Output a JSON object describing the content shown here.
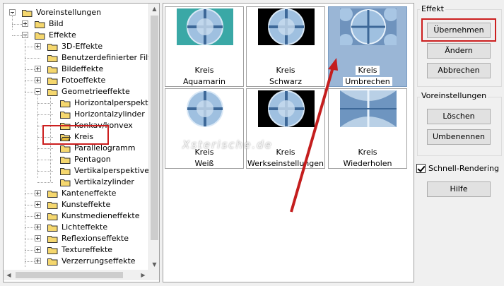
{
  "tree": {
    "items": [
      {
        "label": "Voreinstellungen",
        "level": 0,
        "expander": "minus"
      },
      {
        "label": "Bild",
        "level": 1,
        "expander": "plus"
      },
      {
        "label": "Effekte",
        "level": 1,
        "expander": "minus"
      },
      {
        "label": "3D-Effekte",
        "level": 2,
        "expander": "plus"
      },
      {
        "label": "Benutzerdefinierter Filt",
        "level": 2,
        "expander": "none"
      },
      {
        "label": "Bildeffekte",
        "level": 2,
        "expander": "plus"
      },
      {
        "label": "Fotoeffekte",
        "level": 2,
        "expander": "plus"
      },
      {
        "label": "Geometrieeffekte",
        "level": 2,
        "expander": "minus"
      },
      {
        "label": "Horizontalperspekt",
        "level": 3,
        "expander": "none"
      },
      {
        "label": "Horizontalzylinder",
        "level": 3,
        "expander": "none"
      },
      {
        "label": "Konkav/konvex",
        "level": 3,
        "expander": "none"
      },
      {
        "label": "Kreis",
        "level": 3,
        "expander": "none",
        "selected": true
      },
      {
        "label": "Parallelogramm",
        "level": 3,
        "expander": "none"
      },
      {
        "label": "Pentagon",
        "level": 3,
        "expander": "none"
      },
      {
        "label": "Vertikalperspektive",
        "level": 3,
        "expander": "none"
      },
      {
        "label": "Vertikalzylinder",
        "level": 3,
        "expander": "none"
      },
      {
        "label": "Kanteneffekte",
        "level": 2,
        "expander": "plus"
      },
      {
        "label": "Kunsteffekte",
        "level": 2,
        "expander": "plus"
      },
      {
        "label": "Kunstmedieneffekte",
        "level": 2,
        "expander": "plus"
      },
      {
        "label": "Lichteffekte",
        "level": 2,
        "expander": "plus"
      },
      {
        "label": "Reflexionseffekte",
        "level": 2,
        "expander": "plus"
      },
      {
        "label": "Textureffekte",
        "level": 2,
        "expander": "plus"
      },
      {
        "label": "Verzerrungseffekte",
        "level": 2,
        "expander": "plus"
      }
    ]
  },
  "presets": [
    {
      "line1": "Kreis",
      "line2": "Aquamarin",
      "bg": "#3aa8a6"
    },
    {
      "line1": "Kreis",
      "line2": "Schwarz",
      "bg": "#000000"
    },
    {
      "line1": "Kreis",
      "line2": "Umbrechen",
      "bg": "#6f93bd",
      "selected": true
    },
    {
      "line1": "Kreis",
      "line2": "Weiß",
      "bg": "#ffffff"
    },
    {
      "line1": "Kreis",
      "line2": "Werkseinstellungen",
      "bg": "#000000"
    },
    {
      "line1": "Kreis",
      "line2": "Wiederholen",
      "bg": "#7aa0c8"
    }
  ],
  "watermark": "Xsterische.de",
  "effekt": {
    "title": "Effekt",
    "apply": "Übernehmen",
    "change": "Ändern",
    "cancel": "Abbrechen"
  },
  "voreinstellungen": {
    "title": "Voreinstellungen",
    "delete": "Löschen",
    "rename": "Umbenennen"
  },
  "fast_render": {
    "label": "Schnell-Rendering",
    "checked": true
  },
  "help": "Hilfe",
  "colors": {
    "highlight_red": "#cc1f1f",
    "selected_bg": "#9ab6d6",
    "folder_yellow": "#f5d76e"
  }
}
